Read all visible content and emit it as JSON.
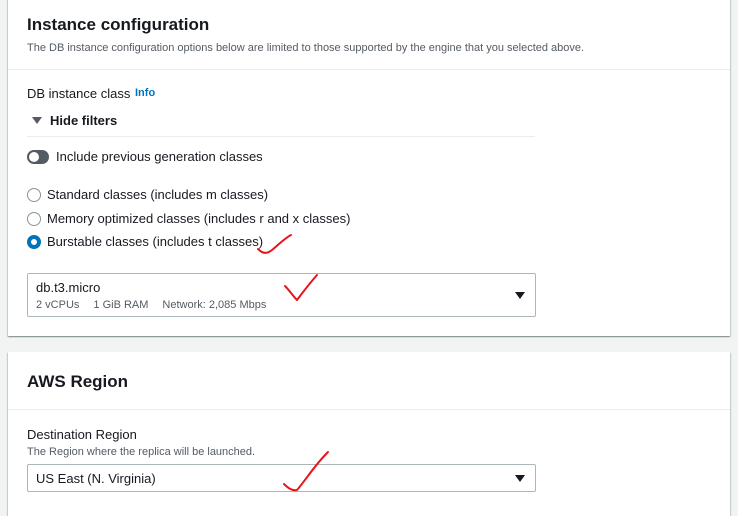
{
  "instance_config": {
    "title": "Instance configuration",
    "description": "The DB instance configuration options below are limited to those supported by the engine that you selected above.",
    "class_label": "DB instance class",
    "info_label": "Info",
    "filters_toggle": "Hide filters",
    "prev_gen_label": "Include previous generation classes",
    "radio_options": [
      {
        "label": "Standard classes (includes m classes)",
        "checked": false
      },
      {
        "label": "Memory optimized classes (includes r and x classes)",
        "checked": false
      },
      {
        "label": "Burstable classes (includes t classes)",
        "checked": true
      }
    ],
    "selected_class": {
      "value": "db.t3.micro",
      "vcpus": "2 vCPUs",
      "ram": "1 GiB RAM",
      "network": "Network: 2,085 Mbps"
    }
  },
  "aws_region": {
    "title": "AWS Region",
    "dest_label": "Destination Region",
    "dest_desc": "The Region where the replica will be launched.",
    "dest_value": "US East (N. Virginia)"
  },
  "colors": {
    "accent": "#0073bb",
    "annotation": "#e8141c",
    "page_bg": "#f2f3f3"
  },
  "icons": [
    "caret-down-icon",
    "toggle-icon",
    "checkmark-annotation-icon"
  ]
}
